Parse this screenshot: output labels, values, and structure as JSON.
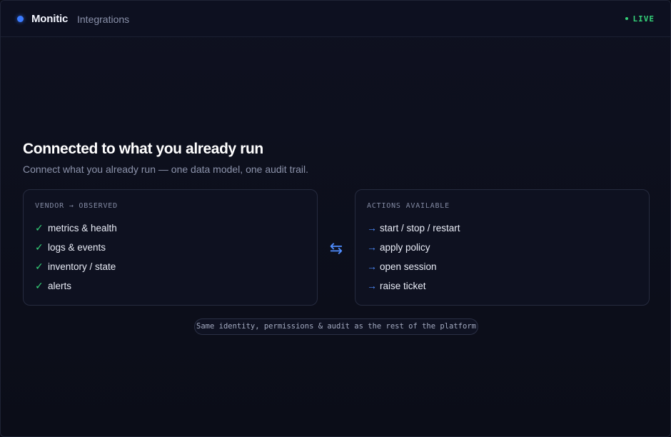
{
  "header": {
    "brand": "Monitic",
    "section": "Integrations",
    "status": "LIVE",
    "status_color": "#34d178",
    "brand_dot_color": "#3b7bff"
  },
  "main": {
    "title": "Connected to what you already run",
    "subtitle": "Connect what you already run — one data model, one audit trail.",
    "left_panel": {
      "title": "VENDOR → OBSERVED",
      "items": [
        {
          "icon": "check-icon",
          "label": "metrics & health"
        },
        {
          "icon": "check-icon",
          "label": "logs & events"
        },
        {
          "icon": "check-icon",
          "label": "inventory / state"
        },
        {
          "icon": "check-icon",
          "label": "alerts"
        }
      ]
    },
    "connector_icon": "swap-arrows-icon",
    "right_panel": {
      "title": "ACTIONS AVAILABLE",
      "items": [
        {
          "icon": "arrow-right-icon",
          "label": "start / stop / restart"
        },
        {
          "icon": "arrow-right-icon",
          "label": "apply policy"
        },
        {
          "icon": "arrow-right-icon",
          "label": "open session"
        },
        {
          "icon": "arrow-right-icon",
          "label": "raise ticket"
        }
      ]
    },
    "footnote": "Same identity, permissions & audit as the rest of the platform"
  }
}
